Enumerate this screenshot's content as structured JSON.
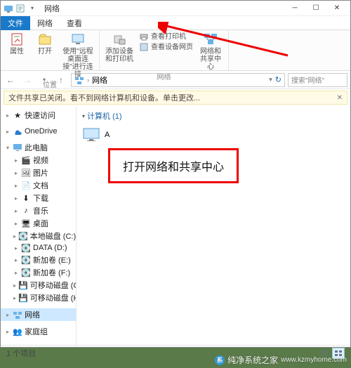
{
  "title": "网络",
  "tabs": {
    "file": "文件",
    "network": "网络",
    "view": "查看"
  },
  "ribbon": {
    "location": {
      "label": "位置",
      "props": "属性",
      "open": "打开",
      "rdp": "使用\"远程桌面连接\"进行连接"
    },
    "network": {
      "label": "网络",
      "add": "添加设备和打印机",
      "viewprn": "查看打印机",
      "viewdev": "查看设备网页",
      "center": "网络和共享中心"
    }
  },
  "address": {
    "path": "网络"
  },
  "search": {
    "placeholder": "搜索\"网络\""
  },
  "infobar": "文件共享已关闭。看不到网络计算机和设备。单击更改...",
  "nav": {
    "quick": "快速访问",
    "onedrive": "OneDrive",
    "thispc": "此电脑",
    "video": "视频",
    "pictures": "图片",
    "documents": "文档",
    "downloads": "下载",
    "music": "音乐",
    "desktop": "桌面",
    "drive_c": "本地磁盘 (C:)",
    "drive_d": "DATA (D:)",
    "drive_e": "新加卷 (E:)",
    "drive_f": "新加卷 (F:)",
    "drive_g": "可移动磁盘 (G:)",
    "drive_h": "可移动磁盘 (H:)",
    "network": "网络",
    "homegroup": "家庭组"
  },
  "content": {
    "group": "计算机 (1)",
    "pc": "A"
  },
  "callout": "打开网络和共享中心",
  "status": {
    "count": "1 个项目"
  },
  "watermark": {
    "brand": "纯净系统之家",
    "url": "www.kzmyhome.com"
  }
}
